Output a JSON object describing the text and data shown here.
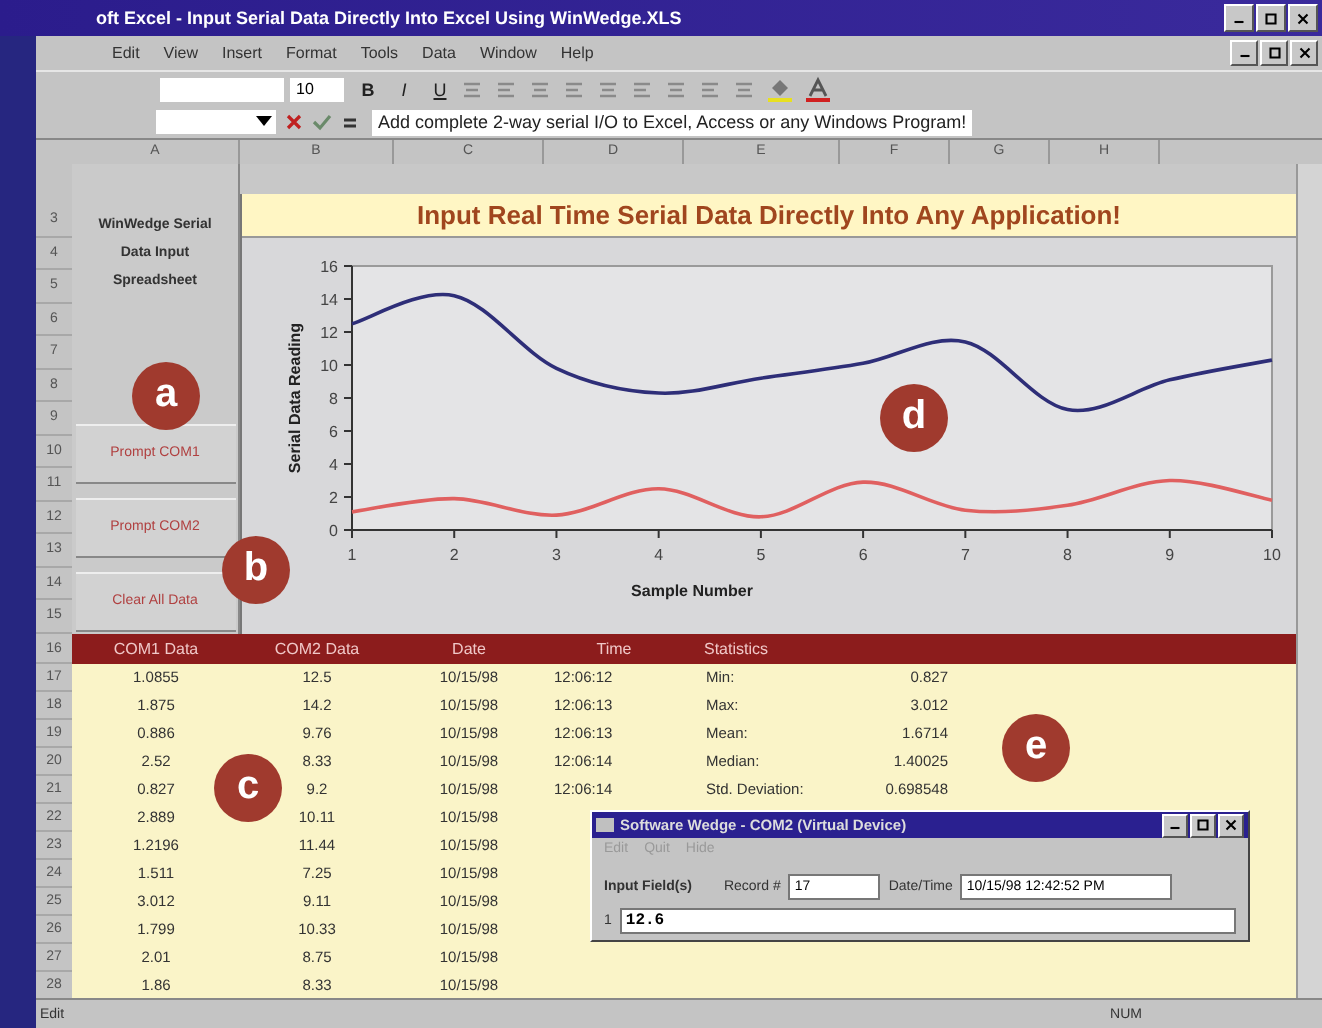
{
  "window": {
    "title": "oft Excel - Input Serial Data Directly Into Excel Using WinWedge.XLS"
  },
  "menu": [
    "Edit",
    "View",
    "Insert",
    "Format",
    "Tools",
    "Data",
    "Window",
    "Help"
  ],
  "toolbar": {
    "font_size": "10",
    "bold": "B",
    "italic": "I",
    "underline": "U"
  },
  "formula_bar": {
    "value": "Add complete 2-way serial I/O to Excel, Access or any Windows Program!"
  },
  "columns": [
    "A",
    "B",
    "C",
    "D",
    "E",
    "F",
    "G",
    "H"
  ],
  "row_numbers": [
    "3",
    "4",
    "5",
    "6",
    "7",
    "8",
    "9",
    "10",
    "11",
    "12",
    "13",
    "14",
    "15",
    "16",
    "17",
    "18",
    "19",
    "20",
    "21",
    "22",
    "23",
    "24",
    "25",
    "26",
    "27",
    "28"
  ],
  "panel": {
    "title": "WinWedge Serial Data Input Spreadsheet",
    "buttons": [
      "Prompt COM1",
      "Prompt COM2",
      "Clear All Data"
    ]
  },
  "chart": {
    "title": "Input Real Time Serial Data Directly Into Any Application!",
    "chart_data": {
      "type": "line",
      "xlabel": "Sample Number",
      "ylabel": "Serial Data Reading",
      "categories": [
        "1",
        "2",
        "3",
        "4",
        "5",
        "6",
        "7",
        "8",
        "9",
        "10"
      ],
      "series": [
        {
          "color": "#2e2e78",
          "values": [
            12.5,
            14.2,
            9.8,
            8.3,
            9.2,
            10.1,
            11.4,
            7.3,
            9.1,
            10.3
          ]
        },
        {
          "color": "#e06060",
          "values": [
            1.1,
            1.9,
            0.9,
            2.5,
            0.8,
            2.9,
            1.2,
            1.5,
            3.0,
            1.8
          ]
        }
      ],
      "ylim": [
        0,
        16
      ],
      "yticks": [
        0,
        2,
        4,
        6,
        8,
        10,
        12,
        14,
        16
      ]
    }
  },
  "table": {
    "columns": [
      "COM1 Data",
      "COM2 Data",
      "Date",
      "Time",
      "Statistics"
    ],
    "rows": [
      {
        "com1": "1.0855",
        "com2": "12.5",
        "date": "10/15/98",
        "time": "12:06:12"
      },
      {
        "com1": "1.875",
        "com2": "14.2",
        "date": "10/15/98",
        "time": "12:06:13"
      },
      {
        "com1": "0.886",
        "com2": "9.76",
        "date": "10/15/98",
        "time": "12:06:13"
      },
      {
        "com1": "2.52",
        "com2": "8.33",
        "date": "10/15/98",
        "time": "12:06:14"
      },
      {
        "com1": "0.827",
        "com2": "9.2",
        "date": "10/15/98",
        "time": "12:06:14"
      },
      {
        "com1": "2.889",
        "com2": "10.11",
        "date": "10/15/98"
      },
      {
        "com1": "1.2196",
        "com2": "11.44",
        "date": "10/15/98"
      },
      {
        "com1": "1.511",
        "com2": "7.25",
        "date": "10/15/98"
      },
      {
        "com1": "3.012",
        "com2": "9.11",
        "date": "10/15/98"
      },
      {
        "com1": "1.799",
        "com2": "10.33",
        "date": "10/15/98"
      },
      {
        "com1": "2.01",
        "com2": "8.75",
        "date": "10/15/98"
      },
      {
        "com1": "1.86",
        "com2": "8.33",
        "date": "10/15/98"
      }
    ]
  },
  "statistics": [
    {
      "label": "Min:",
      "value": "0.827"
    },
    {
      "label": "Max:",
      "value": "3.012"
    },
    {
      "label": "Mean:",
      "value": "1.6714"
    },
    {
      "label": "Median:",
      "value": "1.40025"
    },
    {
      "label": "Std. Deviation:",
      "value": "0.698548"
    }
  ],
  "dialog": {
    "title": "Software Wedge - COM2 (Virtual Device)",
    "menu": [
      "Edit",
      "Quit",
      "Hide"
    ],
    "input_label": "Input Field(s)",
    "record_label": "Record #",
    "record_value": "17",
    "datetime_label": "Date/Time",
    "datetime_value": "10/15/98 12:42:52 PM",
    "field_label": "1",
    "field_value": "12.6"
  },
  "status_bar": {
    "mode": "Edit",
    "indicator": "NUM"
  },
  "callouts": [
    "a",
    "b",
    "c",
    "d",
    "e"
  ]
}
